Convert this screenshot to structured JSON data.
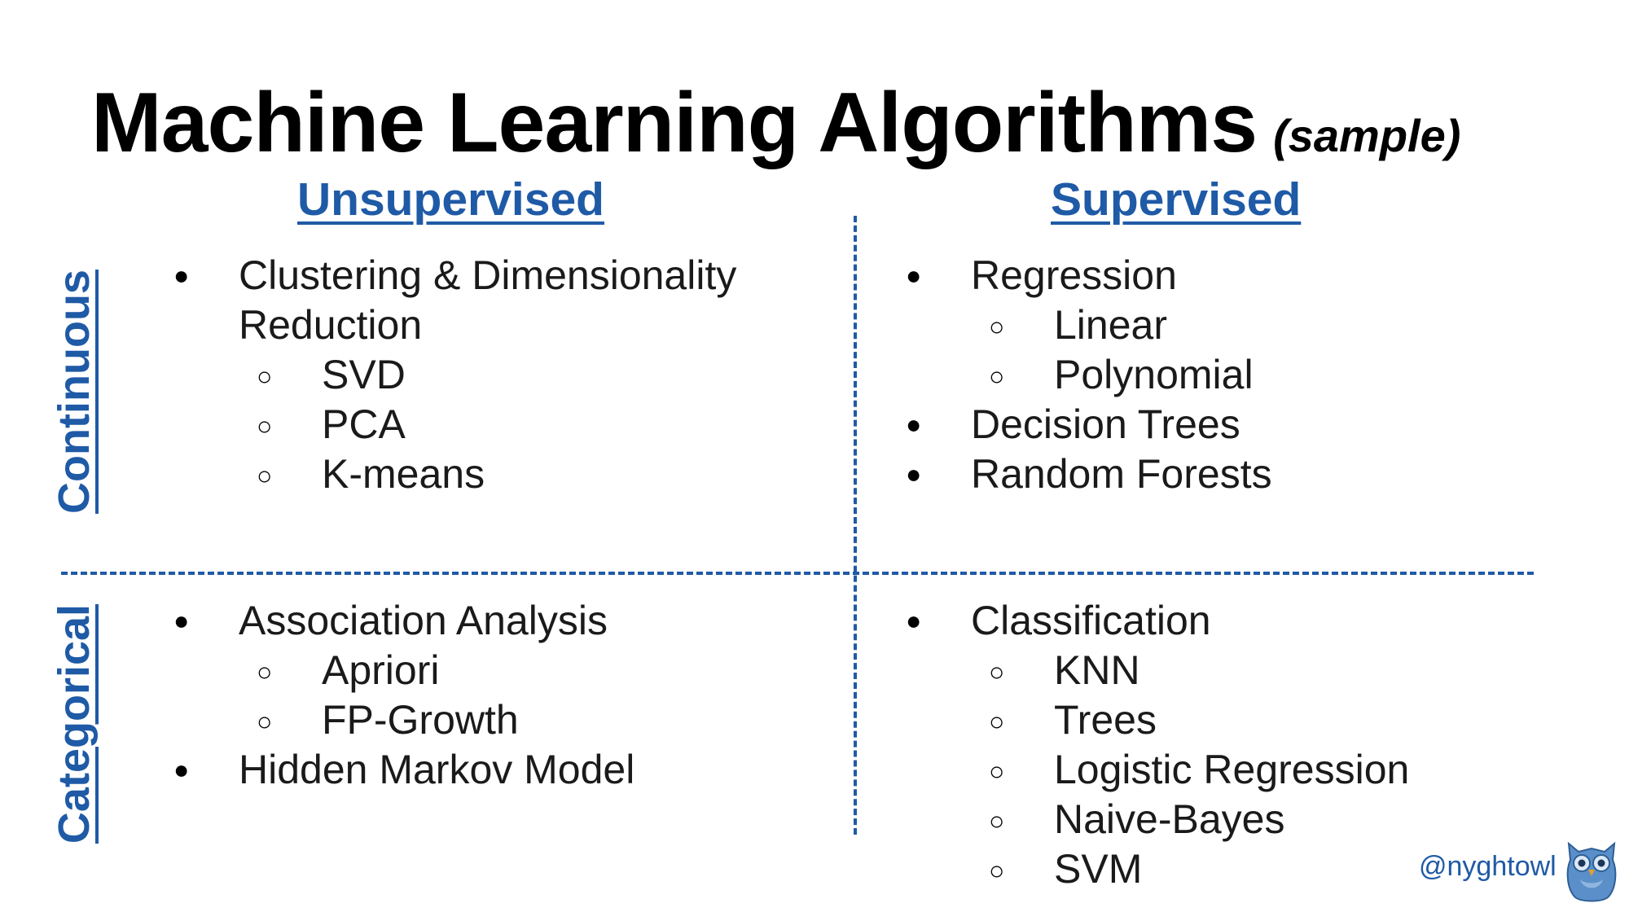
{
  "title": "Machine Learning Algorithms",
  "subtitle": "(sample)",
  "columns": {
    "unsupervised": "Unsupervised",
    "supervised": "Supervised"
  },
  "rows": {
    "continuous": "Continuous",
    "categorical": "Categorical"
  },
  "quadrants": {
    "continuous_unsupervised": [
      {
        "text": "Clustering & Dimensionality",
        "level": 1
      },
      {
        "text": "Reduction",
        "level": 1,
        "continuation": true
      },
      {
        "text": "SVD",
        "level": 2
      },
      {
        "text": "PCA",
        "level": 2
      },
      {
        "text": "K-means",
        "level": 2
      }
    ],
    "continuous_supervised": [
      {
        "text": "Regression",
        "level": 1
      },
      {
        "text": "Linear",
        "level": 2
      },
      {
        "text": "Polynomial",
        "level": 2
      },
      {
        "text": "Decision Trees",
        "level": 1
      },
      {
        "text": "Random Forests",
        "level": 1
      }
    ],
    "categorical_unsupervised": [
      {
        "text": "Association Analysis",
        "level": 1
      },
      {
        "text": "Apriori",
        "level": 2
      },
      {
        "text": "FP-Growth",
        "level": 2
      },
      {
        "text": "Hidden Markov Model",
        "level": 1
      }
    ],
    "categorical_supervised": [
      {
        "text": "Classification",
        "level": 1
      },
      {
        "text": "KNN",
        "level": 2
      },
      {
        "text": "Trees",
        "level": 2
      },
      {
        "text": "Logistic Regression",
        "level": 2
      },
      {
        "text": "Naive-Bayes",
        "level": 2
      },
      {
        "text": "SVM",
        "level": 2
      }
    ]
  },
  "footer": {
    "handle": "@nyghtowl",
    "logo_icon": "owl-icon"
  },
  "colors": {
    "accent": "#1f5aa6",
    "text": "#1a1a1a",
    "title": "#000000"
  }
}
